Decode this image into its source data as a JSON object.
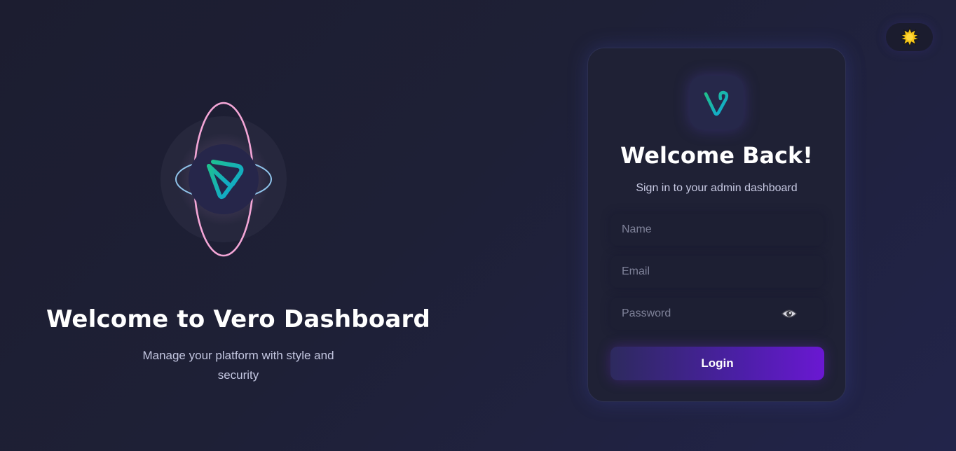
{
  "theme_toggle": {
    "icon": "sun-icon",
    "color": "#f5c518"
  },
  "hero": {
    "logo_icon": "vero-orbit-logo-icon",
    "title": "Welcome to Vero Dashboard",
    "subtitle": "Manage your platform with style and security"
  },
  "login_card": {
    "logo_icon": "vero-v-logo-icon",
    "title": "Welcome Back!",
    "subtitle": "Sign in to your admin dashboard",
    "fields": {
      "name": {
        "value": "",
        "placeholder": "Name"
      },
      "email": {
        "value": "",
        "placeholder": "Email"
      },
      "password": {
        "value": "",
        "placeholder": "Password",
        "toggle_icon": "eye-icon"
      }
    },
    "login_label": "Login"
  },
  "colors": {
    "accent_teal": "#14b8a6",
    "accent_pink": "#f4a6d7",
    "accent_purple": "#6a18d2",
    "background": "#1e2036"
  }
}
